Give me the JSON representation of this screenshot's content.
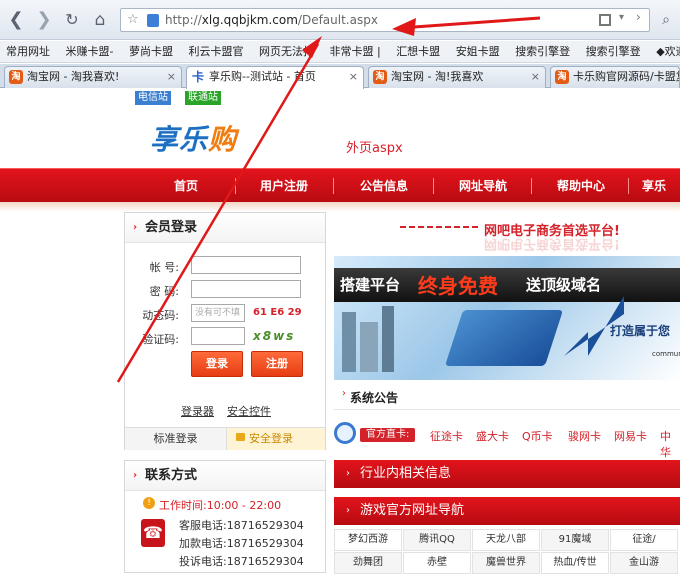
{
  "browser": {
    "url_prefix": "http://",
    "url_domain": "xlg.qqbjkm.com",
    "url_path": "/Default.aspx",
    "bookmarks": [
      "常用网址",
      "米赚卡盟-",
      "萝尚卡盟",
      "利云卡盟官",
      "网页无法打",
      "非常卡盟 |",
      "汇想卡盟",
      "安姐卡盟",
      "搜索引擎登",
      "搜索引擎登",
      "◆欢迎光临"
    ],
    "tabs": [
      {
        "label": "淘宝网 - 淘我喜欢!",
        "icon": "taobao-icon",
        "active": false
      },
      {
        "label": "享乐购--测试站 - 首页",
        "icon": "xiangle-icon",
        "active": true
      },
      {
        "label": "淘宝网 - 淘!我喜欢",
        "icon": "taobao-icon",
        "active": false
      },
      {
        "label": "卡乐购官网源码/卡盟复",
        "icon": "taobao-icon",
        "active": false
      }
    ]
  },
  "site": {
    "chip_telecom": "电信站",
    "chip_unicom": "联通站",
    "logo_main": "享乐",
    "logo_accent": "购",
    "outer_page": "外页aspx",
    "menu": [
      "首页",
      "用户注册",
      "公告信息",
      "网址导航",
      "帮助中心",
      "享乐"
    ]
  },
  "login": {
    "title": "会员登录",
    "account_label": "帐 号:",
    "password_label": "密 码:",
    "dynamic_label": "动态码:",
    "dynamic_placeholder": "没有可不填",
    "dynamic_code": "61 E6 29",
    "captcha_label": "验证码:",
    "captcha_image": "x8ws",
    "login_button": "登录",
    "register_button": "注册",
    "link_login": "登录器",
    "link_security": "安全控件",
    "tab_standard": "标准登录",
    "tab_secure": "安全登录"
  },
  "contact": {
    "title": "联系方式",
    "hours": "工作时间:10:00 - 22:00",
    "lines": [
      "客服电话:18716529304",
      "加款电话:18716529304",
      "投诉电话:18716529304"
    ]
  },
  "main": {
    "slogan": "网吧电子商务首选平台!",
    "banner_prefix": "搭建平台",
    "banner_highlight": "终身免费",
    "banner_suffix": "送顶级域名",
    "banner_right": "打造属于您",
    "banner_small": "communi",
    "notice_title": "系统公告",
    "official_label": "官方直卡:",
    "official_sites": [
      "征途卡",
      "盛大卡",
      "Q币卡",
      "骏网卡",
      "网易卡",
      "中华"
    ],
    "industry_title": "行业内相关信息",
    "gamenav_title": "游戏官方网址导航",
    "games_row1": [
      "梦幻西游",
      "腾讯QQ",
      "天龙八部",
      "91魔域",
      "征途/"
    ],
    "games_row2": [
      "劲舞团",
      "赤壁",
      "魔兽世界",
      "热血/传世",
      "金山游"
    ]
  },
  "colors": {
    "brand_red": "#d4222a",
    "accent_orange": "#f07d12",
    "logo_blue": "#1c6fc2"
  }
}
